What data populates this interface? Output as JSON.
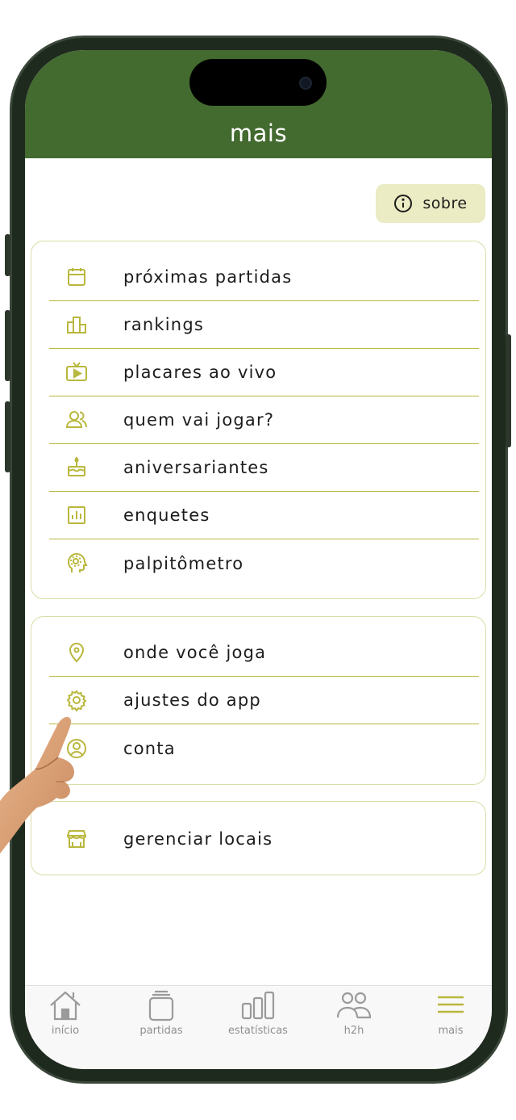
{
  "header": {
    "title": "mais"
  },
  "about_button": {
    "label": "sobre",
    "icon": "info-icon"
  },
  "menu_group_1": {
    "items": [
      {
        "label": "próximas partidas",
        "icon": "calendar-icon"
      },
      {
        "label": "rankings",
        "icon": "podium-icon"
      },
      {
        "label": "placares ao vivo",
        "icon": "tv-play-icon"
      },
      {
        "label": "quem vai jogar?",
        "icon": "people-icon"
      },
      {
        "label": "aniversariantes",
        "icon": "cake-icon"
      },
      {
        "label": "enquetes",
        "icon": "poll-icon"
      },
      {
        "label": "palpitômetro",
        "icon": "head-gear-icon"
      }
    ]
  },
  "menu_group_2": {
    "items": [
      {
        "label": "onde você joga",
        "icon": "location-pin-icon"
      },
      {
        "label": "ajustes do app",
        "icon": "gear-icon"
      },
      {
        "label": "conta",
        "icon": "user-circle-icon"
      }
    ]
  },
  "menu_group_3": {
    "items": [
      {
        "label": "gerenciar locais",
        "icon": "store-icon"
      }
    ]
  },
  "tabbar": {
    "tabs": [
      {
        "label": "início",
        "icon": "home-icon"
      },
      {
        "label": "partidas",
        "icon": "cards-icon"
      },
      {
        "label": "estatísticas",
        "icon": "bar-chart-icon"
      },
      {
        "label": "h2h",
        "icon": "users-icon"
      },
      {
        "label": "mais",
        "icon": "menu-icon",
        "active": true
      }
    ]
  },
  "colors": {
    "header_bg": "#436a2f",
    "accent": "#b9b73d",
    "about_bg": "#ebebc4",
    "card_border": "#dadda7"
  }
}
